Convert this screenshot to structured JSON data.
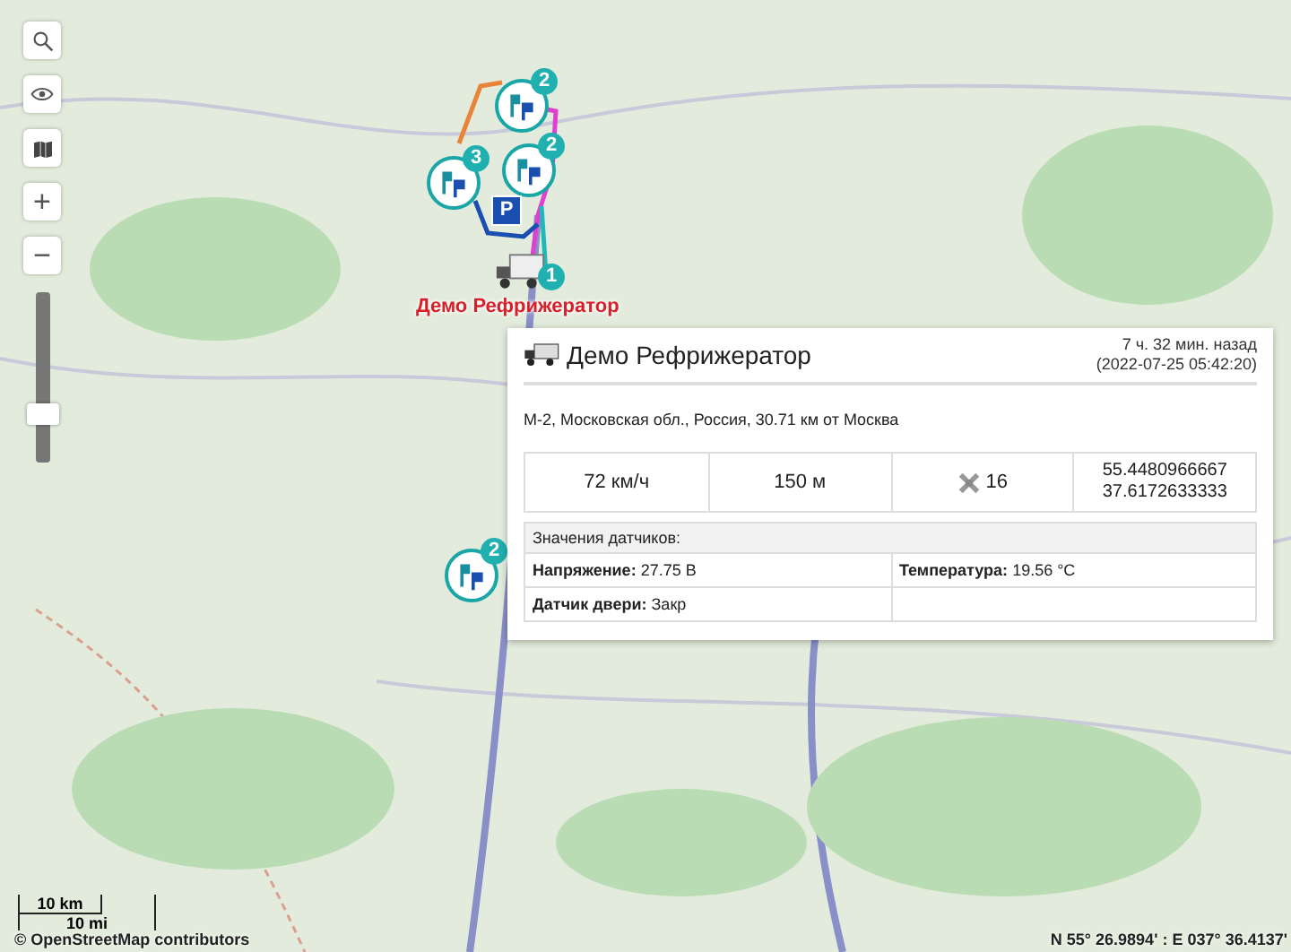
{
  "map_controls": {
    "zoom_in": "+",
    "zoom_out": "−",
    "zoom_slider": {
      "level": 0.22
    }
  },
  "markers": [
    {
      "kind": "cluster",
      "count": "2"
    },
    {
      "kind": "cluster",
      "count": "2"
    },
    {
      "kind": "cluster",
      "count": "3"
    },
    {
      "kind": "cluster",
      "count": "2"
    },
    {
      "kind": "parking",
      "count": "P"
    },
    {
      "kind": "vehicle",
      "count": "1"
    }
  ],
  "vehicle_label": "Демо Рефрижератор",
  "popup": {
    "title": "Демо Рефрижератор",
    "time_ago": "7 ч. 32 мин. назад",
    "timestamp": "(2022-07-25 05:42:20)",
    "address": "М-2, Московская обл., Россия, 30.71 км от Москва",
    "stats": [
      {
        "kind": "speed",
        "text": "72 км/ч"
      },
      {
        "kind": "altitude",
        "text": "150 м"
      },
      {
        "kind": "satellites",
        "text": "16"
      },
      {
        "kind": "coords",
        "lines": [
          "55.4480966667",
          "37.6172633333"
        ]
      }
    ],
    "sensors_heading": "Значения датчиков:",
    "sensors": [
      "**Напряжение:** 27.75 В",
      "**Температура:** 19.56 °C",
      "**Датчик двери:** Закр"
    ]
  },
  "scale": {
    "metric": "10 km",
    "imperial": "10 mi"
  },
  "attribution": "© OpenStreetMap contributors",
  "cursor_coordinates": "N 55° 26.9894' : E 037° 36.4137'"
}
